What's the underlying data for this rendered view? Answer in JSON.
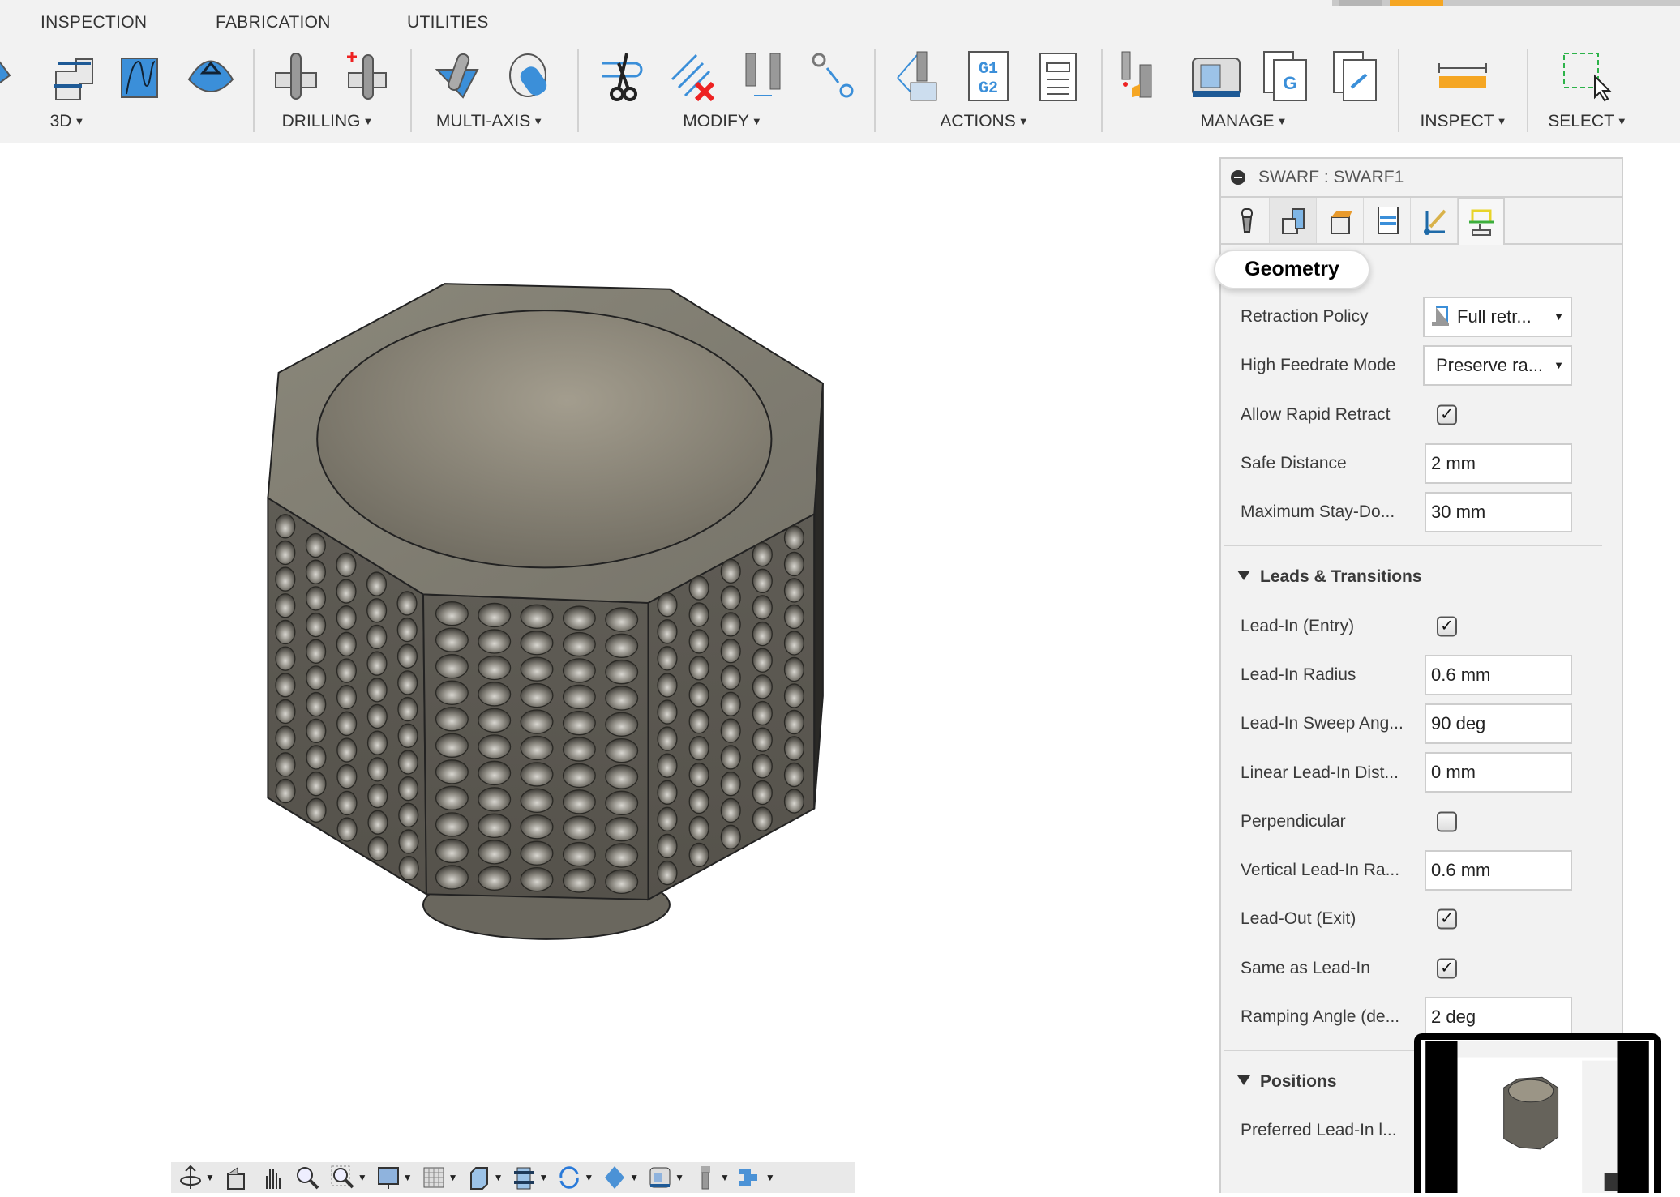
{
  "ribbon": {
    "tabs": [
      "INSPECTION",
      "FABRICATION",
      "UTILITIES"
    ],
    "groups": [
      {
        "label": "3D",
        "icons": [
          "adaptive-clearing-icon",
          "steep-shallow-icon",
          "scallop-icon",
          "pocket-clearing-icon"
        ]
      },
      {
        "label": "DRILLING",
        "icons": [
          "drill-icon",
          "hole-recognition-icon"
        ]
      },
      {
        "label": "MULTI-AXIS",
        "icons": [
          "swarf-icon",
          "multi-axis-contour-icon"
        ]
      },
      {
        "label": "MODIFY",
        "icons": [
          "trim-toolpath-icon",
          "delete-toolpath-icon",
          "tool-compare-icon",
          "move-toolpath-icon"
        ]
      },
      {
        "label": "ACTIONS",
        "icons": [
          "simulate-icon",
          "post-process-icon",
          "setup-sheet-icon"
        ]
      },
      {
        "label": "MANAGE",
        "icons": [
          "tool-library-icon",
          "machine-library-icon",
          "template-library-icon",
          "post-library-icon"
        ]
      },
      {
        "label": "INSPECT",
        "icons": [
          "measure-icon"
        ]
      },
      {
        "label": "SELECT",
        "icons": [
          "select-window-icon"
        ]
      }
    ],
    "progress_color": "#f5a623"
  },
  "panel": {
    "title": "SWARF : SWARF1",
    "tabs": [
      "tool-tab-icon",
      "geometry-tab-icon",
      "heights-tab-icon",
      "passes-tab-icon",
      "linking-tab-icon",
      "linking-active-tab-icon"
    ],
    "active_tab": 5,
    "tooltip": "Geometry",
    "sections": [
      {
        "header": null,
        "rows": [
          {
            "label": "Retraction Policy",
            "type": "dropdown",
            "value": "Full retr...",
            "icon": "full-retraction-icon"
          },
          {
            "label": "High Feedrate Mode",
            "type": "dropdown",
            "value": "Preserve ra..."
          },
          {
            "label": "Allow Rapid Retract",
            "type": "checkbox",
            "checked": true
          },
          {
            "label": "Safe Distance",
            "type": "input",
            "value": "2 mm"
          },
          {
            "label": "Maximum Stay-Do...",
            "type": "input",
            "value": "30 mm"
          }
        ]
      },
      {
        "header": "Leads & Transitions",
        "rows": [
          {
            "label": "Lead-In (Entry)",
            "type": "checkbox",
            "checked": true
          },
          {
            "label": "Lead-In Radius",
            "type": "input",
            "value": "0.6 mm"
          },
          {
            "label": "Lead-In Sweep Ang...",
            "type": "input",
            "value": "90 deg"
          },
          {
            "label": "Linear Lead-In Dist...",
            "type": "input",
            "value": "0 mm"
          },
          {
            "label": "Perpendicular",
            "type": "checkbox",
            "checked": false
          },
          {
            "label": "Vertical Lead-In Ra...",
            "type": "input",
            "value": "0.6 mm"
          },
          {
            "label": "Lead-Out (Exit)",
            "type": "checkbox",
            "checked": true
          },
          {
            "label": "Same as Lead-In",
            "type": "checkbox",
            "checked": true
          },
          {
            "label": "Ramping Angle (de...",
            "type": "input",
            "value": "2 deg"
          }
        ]
      },
      {
        "header": "Positions",
        "rows": [
          {
            "label": "Preferred Lead-In l...",
            "type": "label"
          }
        ]
      }
    ]
  },
  "viewport_toolbar": {
    "icons": [
      "orbit-icon",
      "look-at-icon",
      "pan-icon",
      "zoom-icon",
      "zoom-window-icon",
      "display-mode-icon",
      "grid-icon",
      "view-cube-icon",
      "stock-icon",
      "rotate-icon",
      "appearance-icon",
      "machine-icon",
      "tool-icon",
      "toolpath-icon"
    ]
  }
}
